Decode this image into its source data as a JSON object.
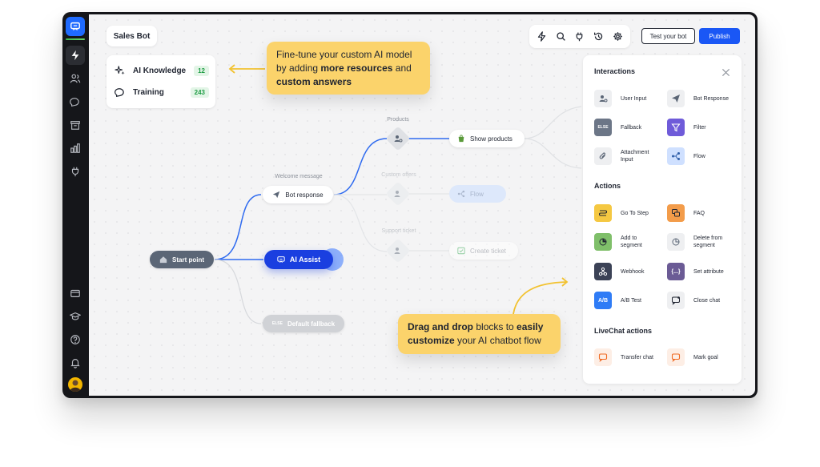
{
  "topbar": {
    "bot_name": "Sales Bot",
    "test_button": "Test your bot",
    "publish_button": "Publish"
  },
  "knowledge": {
    "items": [
      {
        "label": "AI Knowledge",
        "count": "12",
        "icon": "sparkles-icon"
      },
      {
        "label": "Training",
        "count": "243",
        "icon": "chat-refresh-icon"
      }
    ]
  },
  "callouts": {
    "top": {
      "line1": "Fine-tune your custom AI model",
      "line2_pre": "by adding ",
      "line2_bold": "more resources",
      "line2_post": " and",
      "line3_bold": "custom answers"
    },
    "bottom": {
      "bold1": "Drag and drop",
      "text1": " blocks to ",
      "bold2": "easily",
      "bold3": "customize",
      "text2": " your AI chatbot flow"
    }
  },
  "flow": {
    "start": "Start point",
    "ai_assist": "AI Assist",
    "welcome_label": "Welcome message",
    "bot_response": "Bot response",
    "fallback_badge": "ELSE",
    "default_fallback": "Default fallback",
    "products_label": "Products",
    "show_products": "Show products",
    "custom_offers_label": "Custom offers",
    "flow_node": "Flow",
    "support_ticket_label": "Support ticket",
    "create_ticket": "Create ticket"
  },
  "panel": {
    "interactions_title": "Interactions",
    "interactions": [
      {
        "label": "User Input",
        "icon": "user-input-icon",
        "color": "#eeeff1"
      },
      {
        "label": "Bot Response",
        "icon": "send-icon",
        "color": "#eeeff1"
      },
      {
        "label": "Fallback",
        "icon": "else-icon",
        "color": "#6c7687",
        "badge": "ELSE"
      },
      {
        "label": "Filter",
        "icon": "filter-icon",
        "color": "#6f5bd9"
      },
      {
        "label": "Attachment\nInput",
        "icon": "paperclip-icon",
        "color": "#eeeff1"
      },
      {
        "label": "Flow",
        "icon": "flow-icon",
        "color": "#cfe0ff"
      }
    ],
    "actions_title": "Actions",
    "actions": [
      {
        "label": "Go To Step",
        "icon": "go-to-step-icon",
        "color": "#f5c842"
      },
      {
        "label": "FAQ",
        "icon": "faq-icon",
        "color": "#f39c4a"
      },
      {
        "label": "Add to\nsegment",
        "icon": "add-segment-icon",
        "color": "#7fbf6a"
      },
      {
        "label": "Delete from\nsegment",
        "icon": "delete-segment-icon",
        "color": "#eeeff1"
      },
      {
        "label": "Webhook",
        "icon": "webhook-icon",
        "color": "#3b4256"
      },
      {
        "label": "Set attribute",
        "icon": "set-attribute-icon",
        "color": "#6b5b95"
      },
      {
        "label": "A/B Test",
        "icon": "ab-test-icon",
        "color": "#2f7cf6"
      },
      {
        "label": "Close chat",
        "icon": "close-chat-icon",
        "color": "#eeeff1"
      }
    ],
    "livechat_title": "LiveChat actions",
    "livechat": [
      {
        "label": "Transfer chat",
        "icon": "transfer-chat-icon",
        "color": "#fdeee5"
      },
      {
        "label": "Mark goal",
        "icon": "mark-goal-icon",
        "color": "#fdeee5"
      }
    ]
  }
}
